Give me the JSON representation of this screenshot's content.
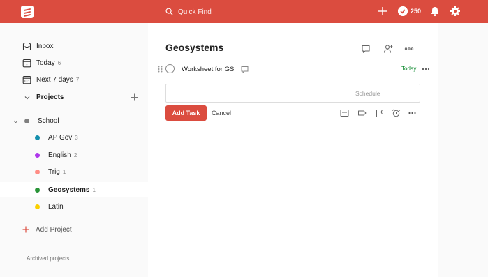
{
  "topbar": {
    "search_placeholder": "Quick Find",
    "karma_count": "250",
    "accent": "#db4c3f"
  },
  "sidebar": {
    "nav": [
      {
        "label": "Inbox",
        "count": "",
        "icon": "inbox-icon"
      },
      {
        "label": "Today",
        "count": "6",
        "icon": "calendar-today-icon"
      },
      {
        "label": "Next 7 days",
        "count": "7",
        "icon": "calendar-week-icon"
      }
    ],
    "projects_heading": "Projects",
    "projects": [
      {
        "label": "School",
        "count": "",
        "color": "#808080"
      },
      {
        "label": "AP Gov",
        "count": "3",
        "color": "#158fad"
      },
      {
        "label": "English",
        "count": "2",
        "color": "#af38eb"
      },
      {
        "label": "Trig",
        "count": "1",
        "color": "#ff8d85"
      },
      {
        "label": "Geosystems",
        "count": "1",
        "color": "#299438"
      },
      {
        "label": "Latin",
        "count": "",
        "color": "#fad000"
      }
    ],
    "add_project": "Add Project",
    "archived": "Archived projects"
  },
  "main": {
    "title": "Geosystems",
    "task": {
      "content": "Worksheet for GS",
      "due": "Today"
    },
    "editor": {
      "value": "",
      "schedule_placeholder": "Schedule",
      "add_label": "Add Task",
      "cancel_label": "Cancel"
    }
  }
}
